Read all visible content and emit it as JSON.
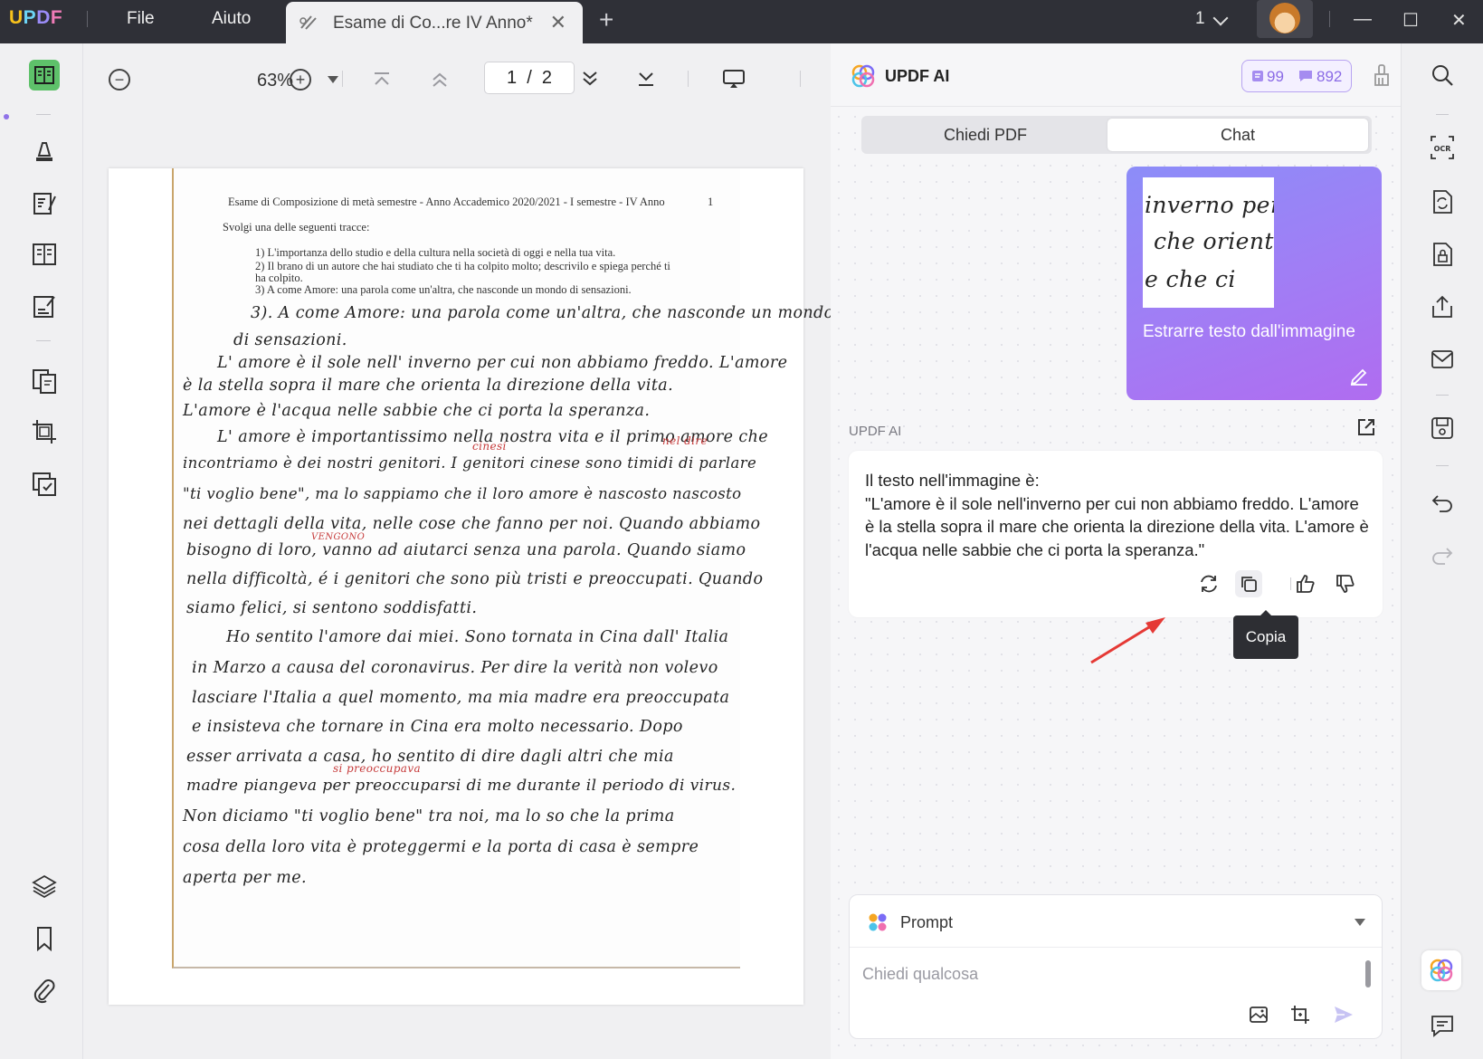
{
  "titlebar": {
    "logo": {
      "u": "U",
      "p": "P",
      "d": "D",
      "f": "F"
    },
    "menu": [
      "File",
      "Aiuto"
    ],
    "tab_title": "Esame di Co...re IV Anno*",
    "tab_close": "✕",
    "tab_add": "+",
    "page_selector": "1",
    "window_controls": [
      "—",
      "☐",
      "✕"
    ]
  },
  "toolbar": {
    "zoom_out": "−",
    "zoom": "63%",
    "zoom_in": "+",
    "page_current": "1",
    "page_total": "2"
  },
  "document": {
    "printed_lines": [
      "Esame di Composizione di metà semestre  -  Anno Accademico 2020/2021 - I semestre - IV Anno",
      "Svolgi una delle seguenti tracce:",
      "1)  L'importanza dello studio e della cultura nella società di oggi e nella tua vita.",
      "2)  Il brano di un autore che hai studiato che ti ha colpito molto; descrivilo e spiega perché ti",
      "      ha colpito.",
      "3)  A come Amore: una parola come un'altra, che nasconde un mondo di sensazioni."
    ],
    "handwritten_lines": [
      "3). A come Amore: una parola come un'altra, che nasconde un mondo",
      "di sensazioni.",
      "L' amore è il sole nell' inverno per cui non abbiamo freddo. L'amore",
      "è la stella sopra il mare che orienta la direzione della vita.",
      "L'amore è l'acqua nelle sabbie che ci porta la speranza.",
      "L' amore è importantissimo nella nostra vita e il primo amore che",
      "incontriamo è dei nostri genitori. I genitori cinese sono timidi di parlare",
      "\"ti voglio bene\", ma lo sappiamo che il loro amore è nascosto nascosto",
      "nei dettagli della vita, nelle cose che fanno per noi. Quando abbiamo",
      "bisogno di loro, vanno ad aiutarci senza una parola. Quando siamo",
      "nella difficoltà, é i genitori che sono più tristi e preoccupati. Quando",
      "siamo felici, si sentono soddisfatti.",
      "Ho sentito l'amore dai miei. Sono tornata in Cina dall' Italia",
      "in Marzo a causa del coronavirus. Per dire la verità non volevo",
      "lasciare l'Italia a quel momento, ma mia madre era preoccupata",
      "e insisteva che tornare in Cina era molto necessario. Dopo",
      "esser arrivata a casa, ho sentito di dire dagli altri che mia",
      "madre piangeva per preoccuparsi di me durante il periodo di virus.",
      "Non diciamo \"ti voglio bene\" tra noi, ma lo so che la prima",
      "cosa della loro vita è proteggermi e la porta di casa è sempre",
      "aperta per me."
    ],
    "corrections": [
      "cinesi",
      "nel dire",
      "VENGONO",
      "si preoccupava"
    ],
    "page_mark": "1"
  },
  "ai": {
    "title": "UPDF AI",
    "credits_doc": "99",
    "credits_chat": "892",
    "tabs": [
      "Chiedi PDF",
      "Chat"
    ],
    "thumb_lines": [
      "inverno  per",
      "che  orient",
      "e  che  ci"
    ],
    "user_message": "Estrarre testo dall'immagine",
    "sender_label": "UPDF AI",
    "answer_intro": "Il testo nell'immagine è:",
    "answer_body": "\"L'amore è il sole nell'inverno per cui non abbiamo freddo. L'amore è la stella sopra il mare che orienta la direzione della vita. L'amore è l'acqua nelle sabbie che ci porta la speranza.\"",
    "tooltip": "Copia",
    "prompt_label": "Prompt",
    "input_placeholder": "Chiedi qualcosa"
  },
  "icons": {
    "left": [
      "reader-icon",
      "comment-icon",
      "edit-pdf-icon",
      "page-organize-icon",
      "fill-sign-icon",
      "convert-icon",
      "crop-icon",
      "protect-icon",
      "layers-icon",
      "bookmark-icon",
      "attachment-icon"
    ],
    "right": [
      "search-icon",
      "ocr-icon",
      "convert-icon",
      "protect-icon",
      "share-icon",
      "email-icon",
      "save-icon",
      "undo-icon",
      "redo-icon",
      "ai-assistant-icon",
      "comments-icon"
    ]
  },
  "colors": {
    "accent": "#8b6be6",
    "active_tool": "#5ec16a",
    "annotation_red": "#e53935",
    "titlebar": "#2f3037"
  }
}
